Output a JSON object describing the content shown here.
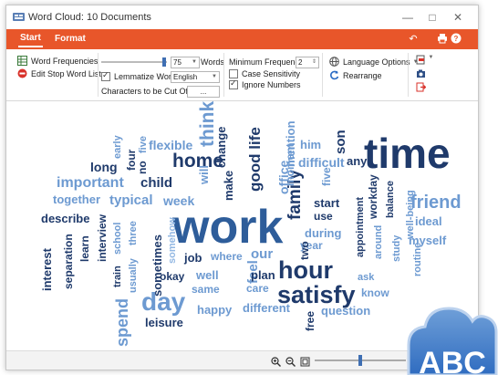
{
  "window": {
    "title": "Word Cloud: 10 Documents",
    "minimize_icon": "minimize-icon",
    "maximize_icon": "maximize-icon",
    "close_icon": "close-icon"
  },
  "tabs": [
    {
      "label": "Start",
      "active": true
    },
    {
      "label": "Format",
      "active": false
    }
  ],
  "tab_icons": [
    "undo-icon",
    "print-icon",
    "help-icon"
  ],
  "accent_color": "#e8562a",
  "ribbon": {
    "word_frequencies": "Word Frequencies",
    "edit_stop_word_list": "Edit Stop Word List",
    "words_value": "75",
    "words_label": "Words",
    "lemmatize_label": "Lemmatize Words",
    "lemmatize_checked": true,
    "language_value": "English",
    "chars_cut_off_label": "Characters to be Cut Off",
    "chars_cut_off_value": "...",
    "min_frequency_label": "Minimum Frequency:",
    "min_frequency_value": "2",
    "case_sensitivity_label": "Case Sensitivity",
    "case_sensitivity_checked": false,
    "ignore_numbers_label": "Ignore Numbers",
    "ignore_numbers_checked": true,
    "language_options": "Language Options",
    "rearrange": "Rearrange",
    "right_icons": [
      "export-icon",
      "copy-image-icon",
      "exit-icon"
    ]
  },
  "cloud_words": [
    {
      "t": "work"
    },
    {
      "t": "time"
    },
    {
      "t": "hour"
    },
    {
      "t": "satisfy"
    },
    {
      "t": "day"
    },
    {
      "t": "home"
    },
    {
      "t": "friend"
    },
    {
      "t": "family"
    },
    {
      "t": "think"
    },
    {
      "t": "good life"
    },
    {
      "t": "child"
    },
    {
      "t": "important"
    },
    {
      "t": "typical"
    },
    {
      "t": "week"
    },
    {
      "t": "flexible"
    },
    {
      "t": "long"
    },
    {
      "t": "four"
    },
    {
      "t": "five"
    },
    {
      "t": "early"
    },
    {
      "t": "no"
    },
    {
      "t": "will"
    },
    {
      "t": "change"
    },
    {
      "t": "make"
    },
    {
      "t": "office"
    },
    {
      "t": "mention"
    },
    {
      "t": "moment"
    },
    {
      "t": "him"
    },
    {
      "t": "son"
    },
    {
      "t": "difficult"
    },
    {
      "t": "any"
    },
    {
      "t": "five"
    },
    {
      "t": "start"
    },
    {
      "t": "use"
    },
    {
      "t": "during"
    },
    {
      "t": "year"
    },
    {
      "t": "together"
    },
    {
      "t": "describe"
    },
    {
      "t": "interest"
    },
    {
      "t": "separation"
    },
    {
      "t": "learn"
    },
    {
      "t": "interview"
    },
    {
      "t": "train"
    },
    {
      "t": "school"
    },
    {
      "t": "usually"
    },
    {
      "t": "three"
    },
    {
      "t": "sometimes"
    },
    {
      "t": "somehow"
    },
    {
      "t": "job"
    },
    {
      "t": "where"
    },
    {
      "t": "our"
    },
    {
      "t": "two"
    },
    {
      "t": "okay"
    },
    {
      "t": "well"
    },
    {
      "t": "feel"
    },
    {
      "t": "plan"
    },
    {
      "t": "same"
    },
    {
      "t": "care"
    },
    {
      "t": "spend"
    },
    {
      "t": "leisure"
    },
    {
      "t": "happy"
    },
    {
      "t": "different"
    },
    {
      "t": "free"
    },
    {
      "t": "question"
    },
    {
      "t": "ask"
    },
    {
      "t": "know"
    },
    {
      "t": "appointment"
    },
    {
      "t": "workday"
    },
    {
      "t": "balance"
    },
    {
      "t": "around"
    },
    {
      "t": "study"
    },
    {
      "t": "routine"
    },
    {
      "t": "well-being"
    },
    {
      "t": "ideal"
    },
    {
      "t": "myself"
    }
  ],
  "statusbar": {
    "zoom_in_icon": "zoom-in-icon",
    "zoom_out_icon": "zoom-out-icon",
    "fit_icon": "fit-page-icon",
    "zoom_level": 0.5
  },
  "badge": {
    "text": "ABC"
  }
}
